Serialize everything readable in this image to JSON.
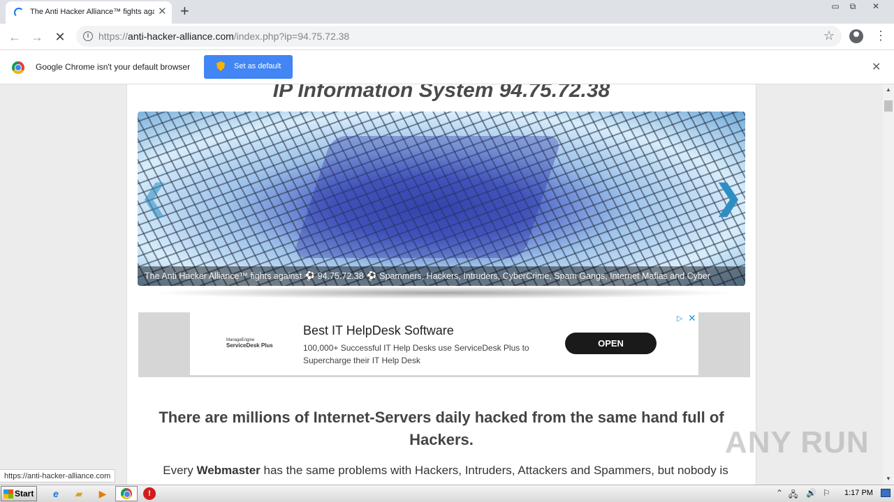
{
  "browser": {
    "tab_title": "The Anti Hacker Alliance™ fights aga",
    "tab_close": "✕",
    "new_tab": "+",
    "window_controls": [
      "▭",
      "⧉",
      "✕"
    ],
    "url_prefix": "https://",
    "url_host": "anti-hacker-alliance.com",
    "url_path": "/index.php?ip=94.75.72.38",
    "back_icon": "←",
    "forward_icon": "→",
    "stop_icon": "✕",
    "star_icon": "☆",
    "menu_icon": "⋮"
  },
  "infobar": {
    "message": "Google Chrome isn't your default browser",
    "button_label": "Set as default",
    "close": "✕"
  },
  "page": {
    "title": "IP Information System 94.75.72.38",
    "banner": {
      "caption": "The Anti Hacker Alliance™ fights against ⚽ 94.75.72.38 ⚽ Spammers, Hackers, Intruders, CyberCrime, Spam Gangs, Internet Mafias and Cyber",
      "prev_arrow": "❮",
      "next_arrow": "❯"
    },
    "ad": {
      "logo_small": "ManageEngine",
      "logo_big": "ServiceDesk Plus",
      "headline": "Best IT HelpDesk Software",
      "description": "100,000+ Successful IT Help Desks use ServiceDesk Plus to Supercharge their IT Help Desk",
      "cta": "OPEN",
      "adchoices": "▷",
      "close": "✕"
    },
    "headline": "There are millions of Internet-Servers daily hacked from the same hand full of Hackers.",
    "paragraph_prefix": "Every ",
    "paragraph_strong": "Webmaster",
    "paragraph_rest": " has the same problems with Hackers, Intruders, Attackers and Spammers, but nobody is"
  },
  "status_bar": {
    "url": "https://anti-hacker-alliance.com"
  },
  "scrollbar": {
    "up": "▲",
    "down": "▼"
  },
  "watermark": "ANY RUN",
  "taskbar": {
    "start_label": "Start",
    "clock": "1:17 PM",
    "icons": [
      "ie-icon",
      "explorer-icon",
      "media-player-icon",
      "chrome-icon",
      "opera-icon"
    ],
    "tray": [
      "⌃",
      "🖧",
      "🔊",
      "⚐"
    ]
  },
  "colors": {
    "accent": "#4285f4",
    "ad_button": "#1a1a1a",
    "adchoices": "#1a9ad6"
  }
}
